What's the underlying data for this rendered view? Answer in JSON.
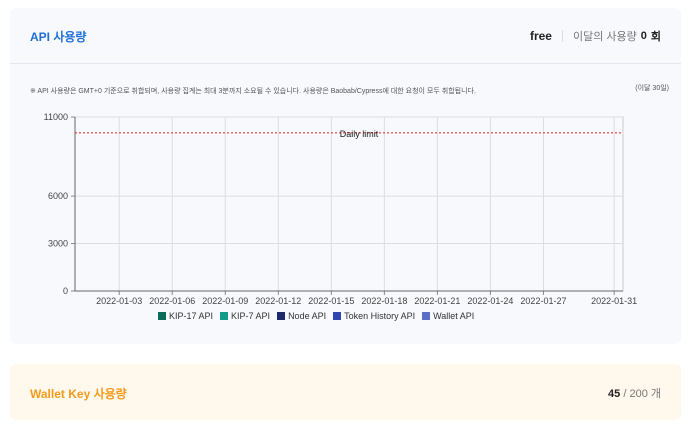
{
  "api_usage": {
    "title": "API 사용량",
    "plan": "free",
    "monthly_label": "이달의 사용량",
    "monthly_count": "0",
    "count_unit": "회",
    "note": "※ API 사용량은 GMT+0 기준으로 취합되며, 사용량 집계는 최대 3분까지 소요될 수 있습니다. 사용량은 Baobab/Cypress에 대한 요청이 모두 취합됩니다.",
    "period": "(이달 30일)"
  },
  "chart_data": {
    "type": "bar",
    "x_range": [
      0.5,
      31.5
    ],
    "ylim": [
      0,
      11000
    ],
    "x_ticks": [
      {
        "day": 3,
        "label": "2022-01-03"
      },
      {
        "day": 6,
        "label": "2022-01-06"
      },
      {
        "day": 9,
        "label": "2022-01-09"
      },
      {
        "day": 12,
        "label": "2022-01-12"
      },
      {
        "day": 15,
        "label": "2022-01-15"
      },
      {
        "day": 18,
        "label": "2022-01-18"
      },
      {
        "day": 21,
        "label": "2022-01-21"
      },
      {
        "day": 24,
        "label": "2022-01-24"
      },
      {
        "day": 27,
        "label": "2022-01-27"
      },
      {
        "day": 31,
        "label": "2022-01-31"
      }
    ],
    "y_ticks": [
      {
        "value": 0,
        "label": "0"
      },
      {
        "value": 3000,
        "label": "3000"
      },
      {
        "value": 6000,
        "label": "6000"
      },
      {
        "value": 11000,
        "label": "11000"
      }
    ],
    "daily_limit": {
      "value": 10000,
      "label": "Daily limit",
      "color": "#e02020"
    },
    "series": [
      {
        "name": "KIP-17 API",
        "color": "#0d6b5a",
        "values": []
      },
      {
        "name": "KIP-7 API",
        "color": "#139a88",
        "values": []
      },
      {
        "name": "Node API",
        "color": "#1f2a6b",
        "values": []
      },
      {
        "name": "Token History API",
        "color": "#2f45b0",
        "values": []
      },
      {
        "name": "Wallet API",
        "color": "#5b6fc6",
        "values": []
      }
    ]
  },
  "wallet_key": {
    "title": "Wallet Key 사용량",
    "used": "45",
    "limit": "/ 200 개"
  }
}
